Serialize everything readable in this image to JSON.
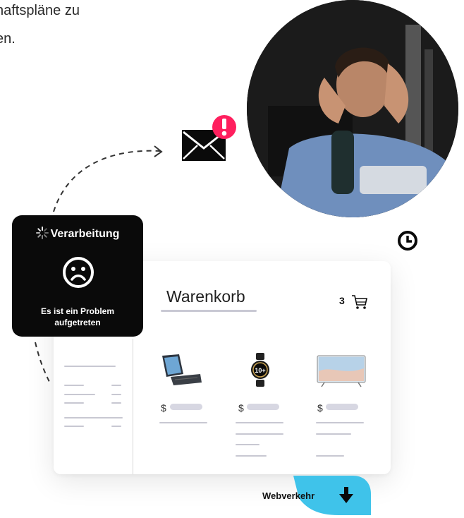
{
  "headline": {
    "line1": "haftspläne zu",
    "line2": "en."
  },
  "panel": {
    "title": "Verarbeitung",
    "message": "Es ist ein Problem aufgetreten",
    "icons": [
      "spinner-icon",
      "sad-face-icon"
    ]
  },
  "cart": {
    "title": "Warenkorb",
    "count": "3",
    "currency": "$",
    "products": [
      "tablet-keyboard",
      "smartwatch",
      "television"
    ]
  },
  "watch_display": "10+",
  "web_traffic": {
    "label": "Webverkehr"
  },
  "icons": {
    "mail": "envelope-icon",
    "alert": "exclamation-icon",
    "clock": "clock-icon",
    "cart": "shopping-cart-icon",
    "arrow": "arrow-down-icon"
  },
  "colors": {
    "alert_pink": "#ff1f5e",
    "traffic_blue": "#3fc3ea",
    "panel_black": "#0a0a0a"
  }
}
